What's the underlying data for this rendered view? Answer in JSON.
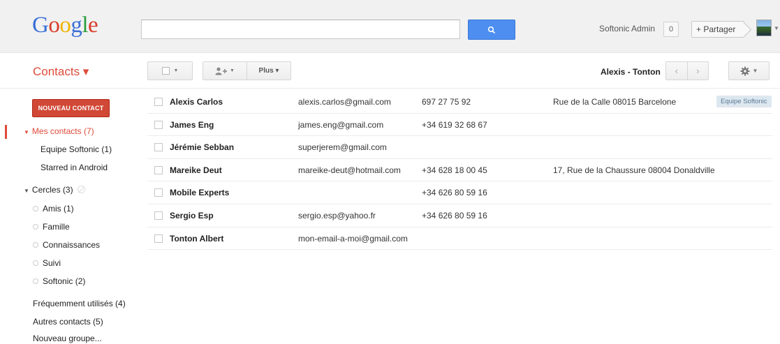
{
  "header": {
    "logo": [
      "G",
      "o",
      "o",
      "g",
      "l",
      "e"
    ],
    "search": {
      "value": "",
      "placeholder": ""
    },
    "search_icon": "search-icon",
    "user_name": "Softonic Admin",
    "notifications": "0",
    "share_label": "+ Partager"
  },
  "toolbar": {
    "app_title": "Contacts ▾",
    "more_label": "Plus ▾",
    "current_contact": "Alexis - Tonton",
    "colors": {
      "accent": "#dd4b39",
      "search_button": "#4d8ef0"
    }
  },
  "sidebar": {
    "new_contact": "NOUVEAU CONTACT",
    "my_contacts": "Mes contacts (7)",
    "my_contacts_children": [
      "Equipe Softonic (1)",
      "Starred in Android"
    ],
    "circles": "Cercles (3)",
    "circle_items": [
      "Amis (1)",
      "Famille",
      "Connaissances",
      "Suivi",
      "Softonic (2)"
    ],
    "frequent": "Fréquemment utilisés (4)",
    "others": "Autres contacts (5)",
    "new_group": "Nouveau groupe..."
  },
  "contacts": [
    {
      "name": "Alexis Carlos",
      "email": "alexis.carlos@gmail.com",
      "phone": "697 27 75 92",
      "address": "Rue de la Calle 08015 Barcelone",
      "label": "Equipe Softonic"
    },
    {
      "name": "James Eng",
      "email": "james.eng@gmail.com",
      "phone": "+34 619 32 68 67",
      "address": "",
      "label": ""
    },
    {
      "name": "Jérémie Sebban",
      "email": "superjerem@gmail.com",
      "phone": "",
      "address": "",
      "label": ""
    },
    {
      "name": "Mareike Deut",
      "email": "mareike-deut@hotmail.com",
      "phone": "+34 628 18 00 45",
      "address": "17, Rue de la Chaussure 08004 Donaldville",
      "label": ""
    },
    {
      "name": "Mobile Experts",
      "email": "",
      "phone": "+34 626 80 59 16",
      "address": "",
      "label": ""
    },
    {
      "name": "Sergio Esp",
      "email": "sergio.esp@yahoo.fr",
      "phone": "+34 626 80 59 16",
      "address": "",
      "label": ""
    },
    {
      "name": "Tonton Albert",
      "email": "mon-email-a-moi@gmail.com",
      "phone": "",
      "address": "",
      "label": ""
    }
  ]
}
